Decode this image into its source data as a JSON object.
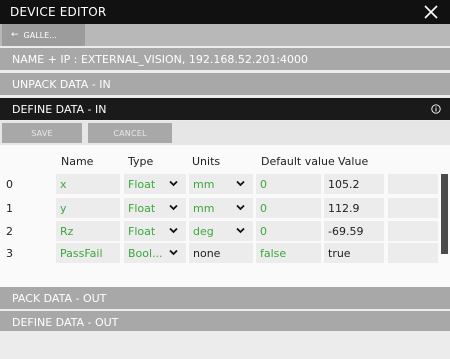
{
  "window": {
    "title": "DEVICE EDITOR"
  },
  "nav": {
    "back_label": "GALLE..."
  },
  "sections": {
    "name_ip": "NAME + IP : EXTERNAL_VISION, 192.168.52.201:4000",
    "unpack_in": "UNPACK DATA - IN",
    "define_in": "DEFINE DATA - IN",
    "pack_out": "PACK DATA - OUT",
    "define_out": "DEFINE DATA - OUT"
  },
  "toolbar": {
    "save_label": "SAVE",
    "cancel_label": "CANCEL"
  },
  "table": {
    "headers": {
      "name": "Name",
      "type": "Type",
      "units": "Units",
      "default": "Default value",
      "value": "Value"
    },
    "rows": [
      {
        "index": "0",
        "name": "x",
        "type": "Float",
        "units": "mm",
        "default": "0",
        "value": "105.2"
      },
      {
        "index": "1",
        "name": "y",
        "type": "Float",
        "units": "mm",
        "default": "0",
        "value": "112.9"
      },
      {
        "index": "2",
        "name": "Rz",
        "type": "Float",
        "units": "deg",
        "default": "0",
        "value": "-69.59"
      },
      {
        "index": "3",
        "name": "PassFail",
        "type": "Bool...",
        "units": "none",
        "default": "false",
        "value": "true"
      }
    ]
  },
  "colors": {
    "editable_text": "#3aa83a",
    "title_bar": "#111111",
    "section_bar": "#a8a8a8"
  }
}
